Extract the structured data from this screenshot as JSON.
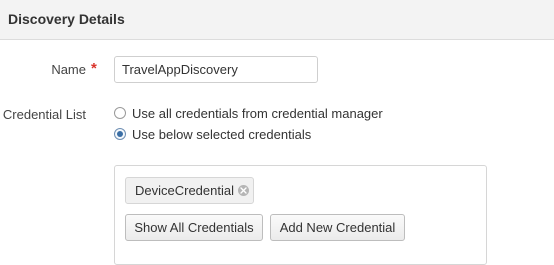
{
  "header": {
    "title": "Discovery Details"
  },
  "form": {
    "name_label": "Name",
    "required_marker": "*",
    "name_value": "TravelAppDiscovery",
    "credential_label": "Credential List",
    "radio_options": [
      {
        "label": "Use all credentials from credential manager",
        "checked": false
      },
      {
        "label": "Use below selected credentials",
        "checked": true
      }
    ]
  },
  "credentials": {
    "selected": [
      {
        "label": "DeviceCredential"
      }
    ],
    "show_all_label": "Show All Credentials",
    "add_new_label": "Add New Credential"
  },
  "colors": {
    "required": "#d9342b",
    "radio_selected": "#3a6ea5",
    "header_bg": "#f3f3f3"
  }
}
